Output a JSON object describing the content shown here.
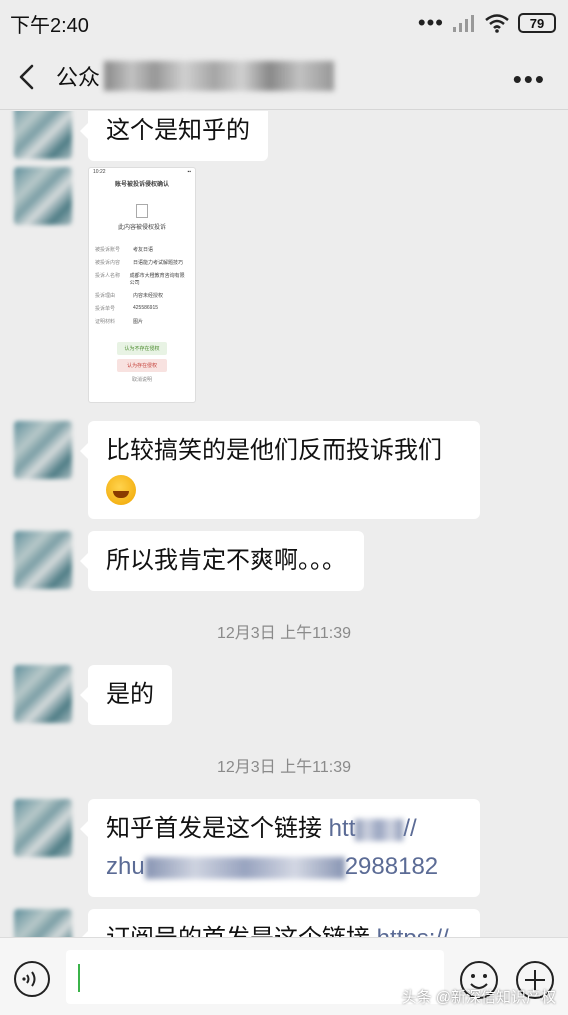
{
  "status_bar": {
    "time": "下午2:40",
    "battery": "79"
  },
  "header": {
    "title_visible": "公众",
    "title_end": "号"
  },
  "messages": [
    {
      "type": "text",
      "text": "这个是知乎的"
    },
    {
      "type": "image",
      "mini": {
        "title": "账号被投诉侵权确认",
        "heading": "此内容被侵权投诉",
        "rows": [
          [
            "被投诉账号",
            "考友日语"
          ],
          [
            "被投诉内容",
            "日语能力考试解题技巧"
          ],
          [
            "投诉人名称",
            "成都市大橙教育咨询有限公司"
          ],
          [
            "投诉理由",
            "内容未经授权"
          ],
          [
            "投诉单号",
            "425586915"
          ],
          [
            "证明材料",
            "图片"
          ]
        ],
        "btn_accept": "认为不存在侵权",
        "btn_reject": "认为存在侵权",
        "footer": "取消说明"
      }
    },
    {
      "type": "text",
      "text": "比较搞笑的是他们反而投诉我们",
      "emoji": "facepalm-emoji"
    },
    {
      "type": "text",
      "text": "所以我肯定不爽啊。。。"
    },
    {
      "type": "time",
      "text": "12月3日 上午11:39"
    },
    {
      "type": "text",
      "text": "是的"
    },
    {
      "type": "time",
      "text": "12月3日 上午11:39"
    },
    {
      "type": "text",
      "text": "知乎首发是这个链接 ",
      "link_start": "htt",
      "link_end": "//",
      "line2_start": "zhu",
      "line2_end": "2988182"
    },
    {
      "type": "text",
      "text": "订阅号的首发是这个链接 ",
      "link_start": "https://"
    }
  ],
  "input_bar": {
    "placeholder": ""
  },
  "watermark": "头条 @新深信知识产权",
  "colors": {
    "background": "#ededed",
    "bubble": "#ffffff",
    "link": "#5b6b95",
    "caret": "#3bb34a"
  }
}
